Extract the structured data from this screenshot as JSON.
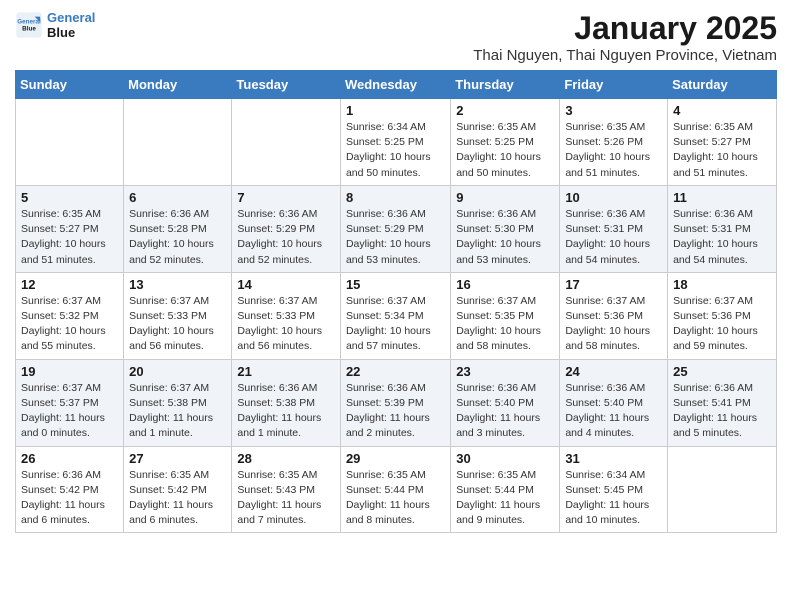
{
  "logo": {
    "line1": "General",
    "line2": "Blue"
  },
  "title": "January 2025",
  "location": "Thai Nguyen, Thai Nguyen Province, Vietnam",
  "days_of_week": [
    "Sunday",
    "Monday",
    "Tuesday",
    "Wednesday",
    "Thursday",
    "Friday",
    "Saturday"
  ],
  "weeks": [
    [
      {
        "day": "",
        "info": ""
      },
      {
        "day": "",
        "info": ""
      },
      {
        "day": "",
        "info": ""
      },
      {
        "day": "1",
        "info": "Sunrise: 6:34 AM\nSunset: 5:25 PM\nDaylight: 10 hours\nand 50 minutes."
      },
      {
        "day": "2",
        "info": "Sunrise: 6:35 AM\nSunset: 5:25 PM\nDaylight: 10 hours\nand 50 minutes."
      },
      {
        "day": "3",
        "info": "Sunrise: 6:35 AM\nSunset: 5:26 PM\nDaylight: 10 hours\nand 51 minutes."
      },
      {
        "day": "4",
        "info": "Sunrise: 6:35 AM\nSunset: 5:27 PM\nDaylight: 10 hours\nand 51 minutes."
      }
    ],
    [
      {
        "day": "5",
        "info": "Sunrise: 6:35 AM\nSunset: 5:27 PM\nDaylight: 10 hours\nand 51 minutes."
      },
      {
        "day": "6",
        "info": "Sunrise: 6:36 AM\nSunset: 5:28 PM\nDaylight: 10 hours\nand 52 minutes."
      },
      {
        "day": "7",
        "info": "Sunrise: 6:36 AM\nSunset: 5:29 PM\nDaylight: 10 hours\nand 52 minutes."
      },
      {
        "day": "8",
        "info": "Sunrise: 6:36 AM\nSunset: 5:29 PM\nDaylight: 10 hours\nand 53 minutes."
      },
      {
        "day": "9",
        "info": "Sunrise: 6:36 AM\nSunset: 5:30 PM\nDaylight: 10 hours\nand 53 minutes."
      },
      {
        "day": "10",
        "info": "Sunrise: 6:36 AM\nSunset: 5:31 PM\nDaylight: 10 hours\nand 54 minutes."
      },
      {
        "day": "11",
        "info": "Sunrise: 6:36 AM\nSunset: 5:31 PM\nDaylight: 10 hours\nand 54 minutes."
      }
    ],
    [
      {
        "day": "12",
        "info": "Sunrise: 6:37 AM\nSunset: 5:32 PM\nDaylight: 10 hours\nand 55 minutes."
      },
      {
        "day": "13",
        "info": "Sunrise: 6:37 AM\nSunset: 5:33 PM\nDaylight: 10 hours\nand 56 minutes."
      },
      {
        "day": "14",
        "info": "Sunrise: 6:37 AM\nSunset: 5:33 PM\nDaylight: 10 hours\nand 56 minutes."
      },
      {
        "day": "15",
        "info": "Sunrise: 6:37 AM\nSunset: 5:34 PM\nDaylight: 10 hours\nand 57 minutes."
      },
      {
        "day": "16",
        "info": "Sunrise: 6:37 AM\nSunset: 5:35 PM\nDaylight: 10 hours\nand 58 minutes."
      },
      {
        "day": "17",
        "info": "Sunrise: 6:37 AM\nSunset: 5:36 PM\nDaylight: 10 hours\nand 58 minutes."
      },
      {
        "day": "18",
        "info": "Sunrise: 6:37 AM\nSunset: 5:36 PM\nDaylight: 10 hours\nand 59 minutes."
      }
    ],
    [
      {
        "day": "19",
        "info": "Sunrise: 6:37 AM\nSunset: 5:37 PM\nDaylight: 11 hours\nand 0 minutes."
      },
      {
        "day": "20",
        "info": "Sunrise: 6:37 AM\nSunset: 5:38 PM\nDaylight: 11 hours\nand 1 minute."
      },
      {
        "day": "21",
        "info": "Sunrise: 6:36 AM\nSunset: 5:38 PM\nDaylight: 11 hours\nand 1 minute."
      },
      {
        "day": "22",
        "info": "Sunrise: 6:36 AM\nSunset: 5:39 PM\nDaylight: 11 hours\nand 2 minutes."
      },
      {
        "day": "23",
        "info": "Sunrise: 6:36 AM\nSunset: 5:40 PM\nDaylight: 11 hours\nand 3 minutes."
      },
      {
        "day": "24",
        "info": "Sunrise: 6:36 AM\nSunset: 5:40 PM\nDaylight: 11 hours\nand 4 minutes."
      },
      {
        "day": "25",
        "info": "Sunrise: 6:36 AM\nSunset: 5:41 PM\nDaylight: 11 hours\nand 5 minutes."
      }
    ],
    [
      {
        "day": "26",
        "info": "Sunrise: 6:36 AM\nSunset: 5:42 PM\nDaylight: 11 hours\nand 6 minutes."
      },
      {
        "day": "27",
        "info": "Sunrise: 6:35 AM\nSunset: 5:42 PM\nDaylight: 11 hours\nand 6 minutes."
      },
      {
        "day": "28",
        "info": "Sunrise: 6:35 AM\nSunset: 5:43 PM\nDaylight: 11 hours\nand 7 minutes."
      },
      {
        "day": "29",
        "info": "Sunrise: 6:35 AM\nSunset: 5:44 PM\nDaylight: 11 hours\nand 8 minutes."
      },
      {
        "day": "30",
        "info": "Sunrise: 6:35 AM\nSunset: 5:44 PM\nDaylight: 11 hours\nand 9 minutes."
      },
      {
        "day": "31",
        "info": "Sunrise: 6:34 AM\nSunset: 5:45 PM\nDaylight: 11 hours\nand 10 minutes."
      },
      {
        "day": "",
        "info": ""
      }
    ]
  ]
}
